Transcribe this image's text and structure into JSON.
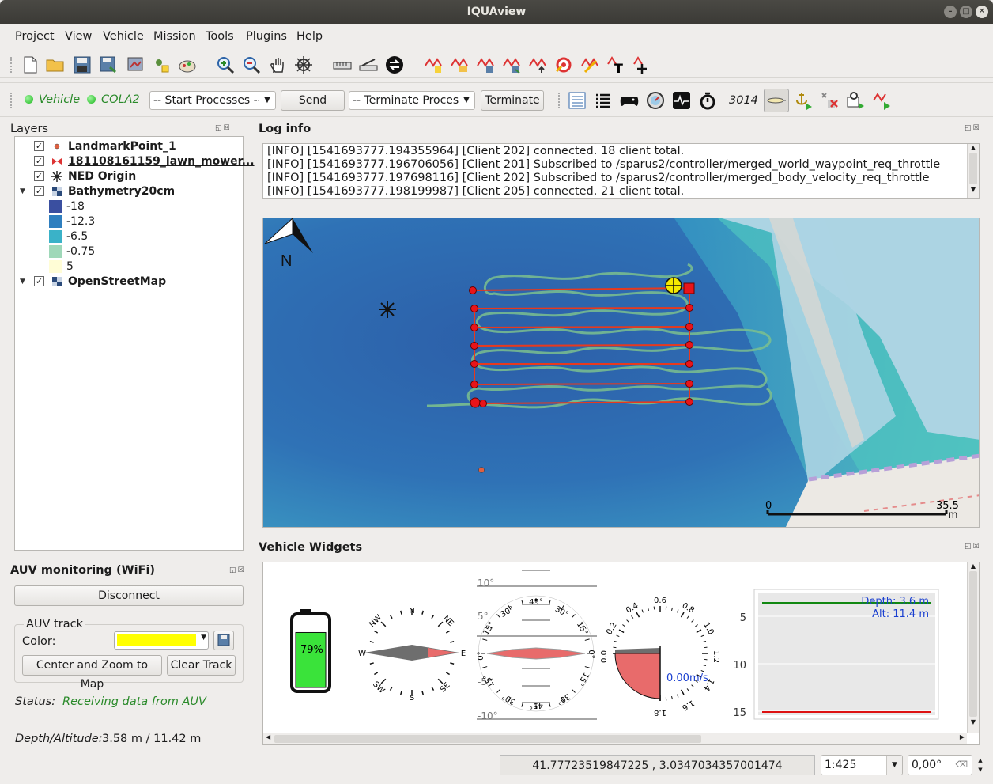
{
  "window": {
    "title": "IQUAview"
  },
  "menu": [
    "Project",
    "View",
    "Vehicle",
    "Mission",
    "Tools",
    "Plugins",
    "Help"
  ],
  "toolbar2": {
    "vehicle_label": "Vehicle",
    "cola2_label": "COLA2",
    "start_processes": "-- Start Processes --",
    "send": "Send",
    "terminate_processes": "-- Terminate Proces:",
    "terminate": "Terminate",
    "id_value": "3014"
  },
  "layers": {
    "title": "Layers",
    "items": [
      {
        "name": "LandmarkPoint_1"
      },
      {
        "name": "181108161159_lawn_mower..."
      },
      {
        "name": "NED Origin"
      },
      {
        "name": "Bathymetry20cm"
      },
      {
        "name": "-18",
        "color": "#3a4fa0"
      },
      {
        "name": "-12.3",
        "color": "#2f7fbf"
      },
      {
        "name": "-6.5",
        "color": "#3ab2c8"
      },
      {
        "name": "-0.75",
        "color": "#9fd8b9"
      },
      {
        "name": "5",
        "color": "#fffdd6"
      },
      {
        "name": "OpenStreetMap"
      }
    ]
  },
  "log": {
    "title": "Log info",
    "lines": [
      "[INFO] [1541693777.194355964] [Client 202] connected. 18 client total.",
      "[INFO] [1541693777.196706056] [Client 201] Subscribed to /sparus2/controller/merged_world_waypoint_req_throttle",
      "[INFO] [1541693777.197698116] [Client 202] Subscribed to /sparus2/controller/merged_body_velocity_req_throttle",
      "[INFO] [1541693777.198199987] [Client 205] connected. 21 client total."
    ]
  },
  "map": {
    "north_label": "N",
    "scale_start": "0",
    "scale_end": "35.5",
    "scale_unit": "m"
  },
  "auv": {
    "title": "AUV monitoring (WiFi)",
    "disconnect": "Disconnect",
    "track_group": "AUV track",
    "color_label": "Color:",
    "track_color": "#ffff00",
    "center_zoom": "Center and Zoom to Map",
    "clear_track": "Clear Track",
    "status_label": "Status:",
    "status_value": "Receiving data from AUV",
    "depth_label": "Depth/Altitude:",
    "depth_value": "3.58 m / 11.42 m"
  },
  "widgets": {
    "title": "Vehicle Widgets",
    "battery": "79%",
    "battery_level": 0.79,
    "compass": {
      "n": "N",
      "ne": "NE",
      "e": "E",
      "se": "SE",
      "s": "S",
      "sw": "SW",
      "w": "W",
      "nw": "NW"
    },
    "attitude": {
      "p10": "10°",
      "p5": "5°",
      "p0": "0°",
      "m5": "-5°",
      "m10": "-10°",
      "r15": "15°",
      "r30": "30°",
      "r45": "45°"
    },
    "speed": {
      "value": "0.00m/s",
      "ticks": [
        "0.0",
        "0.2",
        "0.4",
        "0.6",
        "0.8",
        "1.0",
        "1.2",
        "1.4",
        "1.6",
        "1.8"
      ]
    },
    "depth_plot": {
      "depth_text": "Depth: 3.6 m",
      "alt_text": "Alt: 11.4 m",
      "ticks": [
        "5",
        "10",
        "15"
      ]
    }
  },
  "statusbar": {
    "coords": "41.77723519847225 , 3.0347034357001474",
    "scale": "1:425",
    "rotation": "0,00°"
  }
}
